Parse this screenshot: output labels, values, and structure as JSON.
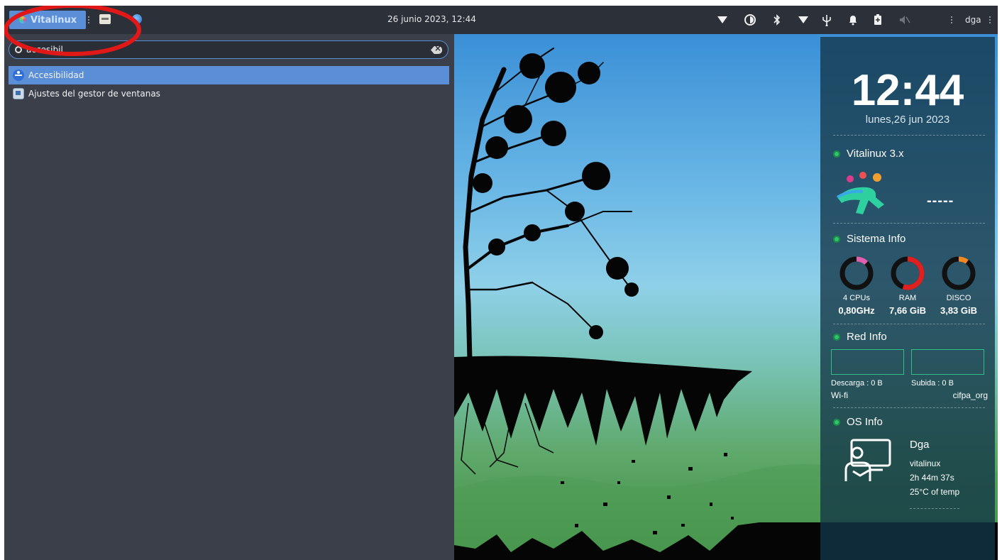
{
  "panel": {
    "menu_label": "Vitalinux",
    "datetime": "26 junio 2023, 12:44",
    "user": "dga",
    "tray_icons": [
      "wifi-icon",
      "contrast-icon",
      "bluetooth-icon",
      "network-icon",
      "usb-icon",
      "bell-icon",
      "battery-icon",
      "volume-muted-icon"
    ]
  },
  "search": {
    "value": "accesibil",
    "placeholder": ""
  },
  "results": [
    {
      "label": "Accesibilidad",
      "icon": "accessibility-icon",
      "selected": true
    },
    {
      "label": "Ajustes del gestor de ventanas",
      "icon": "window-manager-settings-icon",
      "selected": false
    }
  ],
  "conky": {
    "time": "12:44",
    "date": "lunes,26 jun 2023",
    "vitalinux": {
      "title": "Vitalinux 3.x",
      "dashes": "-----"
    },
    "system": {
      "title": "Sistema Info",
      "cpu": {
        "label": "4 CPUs",
        "value": "0,80GHz",
        "usage": 0.12,
        "color": "#e060b0"
      },
      "ram": {
        "label": "RAM",
        "value": "7,66 GiB",
        "usage": 0.55,
        "color": "#e02020"
      },
      "disk": {
        "label": "DISCO",
        "value": "3,83 GiB",
        "usage": 0.1,
        "color": "#f08a20"
      }
    },
    "network": {
      "title": "Red Info",
      "download": "Descarga : 0 B",
      "upload": "Subida : 0 B",
      "interface": "Wi-fi",
      "ssid": "cifpa_org"
    },
    "os": {
      "title": "OS Info",
      "user": "Dga",
      "host": "vitalinux",
      "uptime": "2h 44m 37s",
      "temp": "25°C of temp"
    }
  },
  "colors": {
    "accent": "#5a8fd8",
    "panel_bg": "#2c3039",
    "menu_bg": "#3a3f4a",
    "annotation": "#e01818",
    "status_ok": "#31c46a"
  }
}
